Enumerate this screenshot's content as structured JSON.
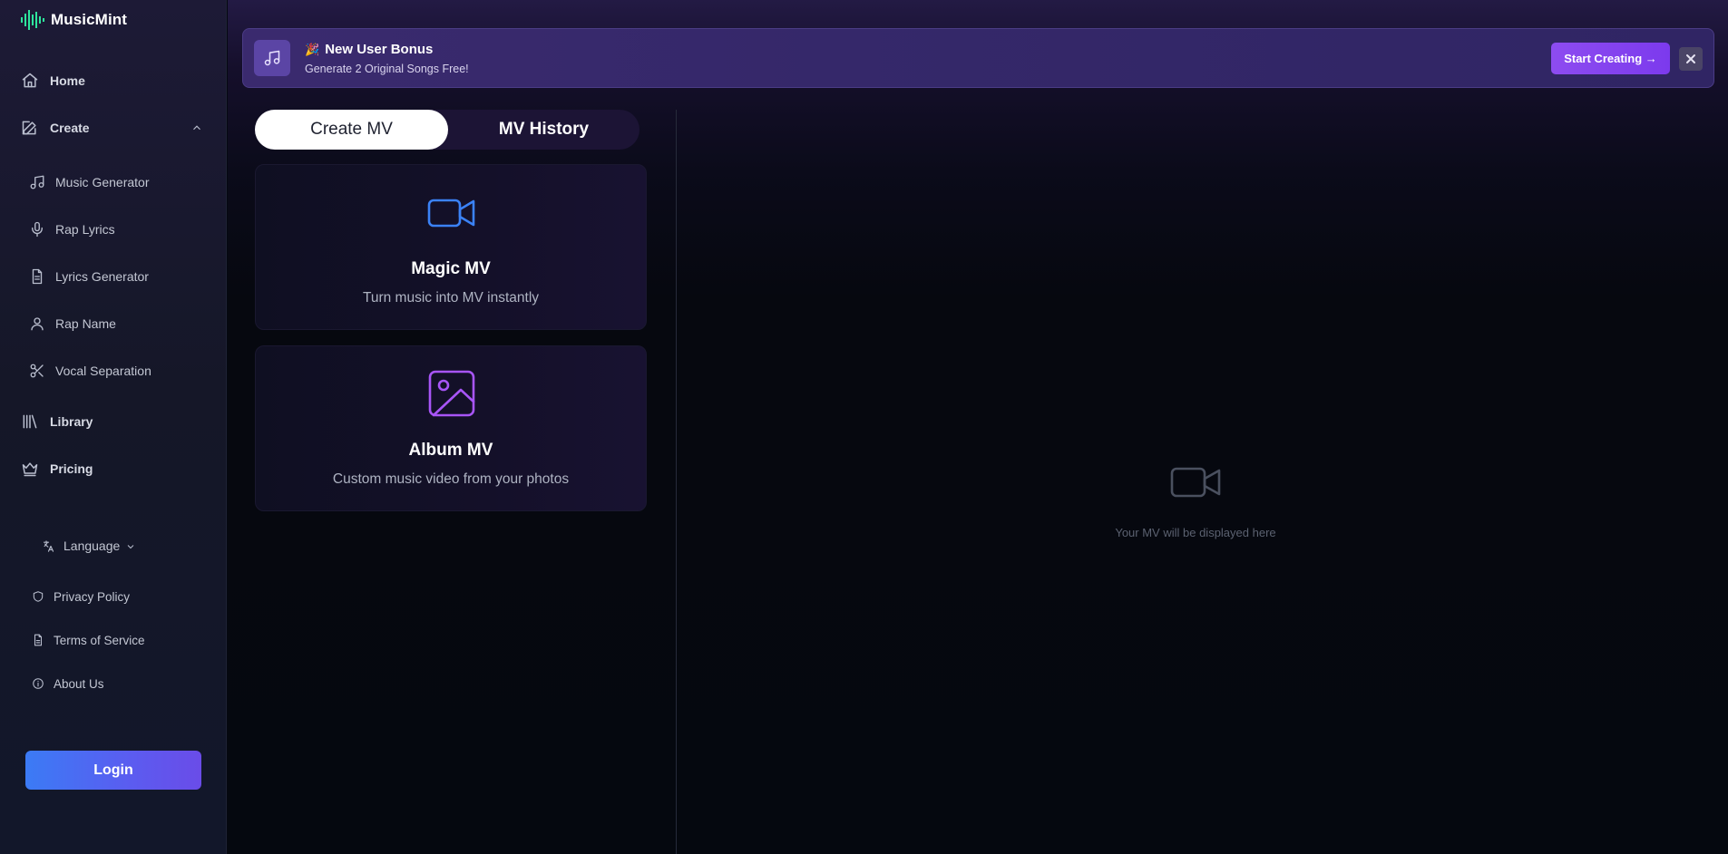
{
  "sidebar": {
    "brand": "MusicMint",
    "home": "Home",
    "create": "Create",
    "create_items": [
      {
        "label": "Music Generator",
        "icon": "music-note-icon"
      },
      {
        "label": "Rap Lyrics",
        "icon": "microphone-icon"
      },
      {
        "label": "Lyrics Generator",
        "icon": "document-icon"
      },
      {
        "label": "Rap Name",
        "icon": "user-icon"
      },
      {
        "label": "Vocal Separation",
        "icon": "scissors-icon"
      }
    ],
    "library": "Library",
    "pricing": "Pricing",
    "language": "Language",
    "footer_links": [
      {
        "label": "Privacy Policy",
        "icon": "shield-icon"
      },
      {
        "label": "Terms of Service",
        "icon": "document-icon"
      },
      {
        "label": "About Us",
        "icon": "info-icon"
      }
    ],
    "login": "Login"
  },
  "banner": {
    "emoji": "🎉",
    "title": "New User Bonus",
    "subtitle": "Generate 2 Original Songs Free!",
    "cta": "Start Creating →"
  },
  "tabs": {
    "create": "Create MV",
    "history": "MV History",
    "active": "Create MV"
  },
  "cards": [
    {
      "title": "Magic MV",
      "desc": "Turn music into MV instantly",
      "icon": "video-camera-icon",
      "color": "#3b82f6"
    },
    {
      "title": "Album MV",
      "desc": "Custom music video from your photos",
      "icon": "image-icon",
      "color": "#a855f7"
    }
  ],
  "preview": {
    "placeholder": "Your MV will be displayed here",
    "icon": "video-camera-icon"
  },
  "colors": {
    "accent": "#7c3aed",
    "login_gradient_start": "#3b7bf5",
    "login_gradient_end": "#6a4ce8"
  }
}
